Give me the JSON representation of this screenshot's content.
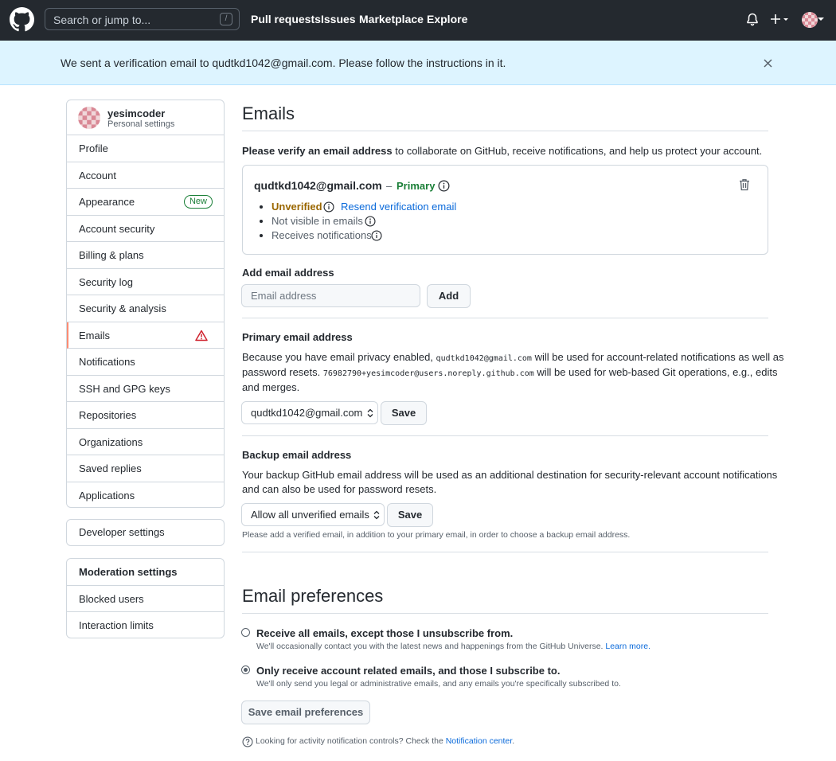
{
  "header": {
    "search_placeholder": "Search or jump to...",
    "search_shortcut": "/",
    "nav": [
      "Pull requests",
      "Issues",
      "Marketplace",
      "Explore"
    ]
  },
  "banner": {
    "message": "We sent a verification email to qudtkd1042@gmail.com. Please follow the instructions in it."
  },
  "sidebar": {
    "username": "yesimcoder",
    "subtitle": "Personal settings",
    "items": [
      "Profile",
      "Account",
      "Appearance",
      "Account security",
      "Billing & plans",
      "Security log",
      "Security & analysis",
      "Emails",
      "Notifications",
      "SSH and GPG keys",
      "Repositories",
      "Organizations",
      "Saved replies",
      "Applications"
    ],
    "new_badge": "New",
    "developer": "Developer settings",
    "moderation_heading": "Moderation settings",
    "moderation_items": [
      "Blocked users",
      "Interaction limits"
    ]
  },
  "emails": {
    "title": "Emails",
    "verify_bold": "Please verify an email address",
    "verify_rest": " to collaborate on GitHub, receive notifications, and help us protect your account.",
    "email": "qudtkd1042@gmail.com",
    "dash": "–",
    "primary": "Primary",
    "unverified": "Unverified",
    "resend": "Resend verification email",
    "not_visible": "Not visible in emails",
    "receives": "Receives notifications",
    "add_heading": "Add email address",
    "add_placeholder": "Email address",
    "add_button": "Add",
    "primary_heading": "Primary email address",
    "primary_p1": "Because you have email privacy enabled, ",
    "primary_code1": "qudtkd1042@gmail.com",
    "primary_p2": " will be used for account-related notifications as well as",
    "primary_p3": "password resets. ",
    "primary_code2": "76982790+yesimcoder@users.noreply.github.com",
    "primary_p4": " will be used for web-based Git operations, e.g., edits",
    "primary_p5": "and merges.",
    "primary_select": "qudtkd1042@gmail.com",
    "save": "Save",
    "backup_heading": "Backup email address",
    "backup_p1": "Your backup GitHub email address will be used as an additional destination for security-relevant account notifications",
    "backup_p2": "and can also be used for password resets.",
    "backup_select": "Allow all unverified emails",
    "backup_note": "Please add a verified email, in addition to your primary email, in order to choose a backup email address."
  },
  "prefs": {
    "title": "Email preferences",
    "opt1_label": "Receive all emails, except those I unsubscribe from.",
    "opt1_note": "We'll occasionally contact you with the latest news and happenings from the GitHub Universe.",
    "opt1_link": "Learn more.",
    "opt2_label": "Only receive account related emails, and those I subscribe to.",
    "opt2_note": "We'll only send you legal or administrative emails, and any emails you're specifically subscribed to.",
    "save_button": "Save email preferences",
    "footer_text": "Looking for activity notification controls? Check the ",
    "footer_link": "Notification center",
    "footer_end": "."
  },
  "colors": {
    "accent": "#0969da",
    "primary_green": "#1a7f37",
    "unverified": "#9a6700",
    "selected_border": "#fd8c73",
    "alert": "#cf222e"
  }
}
